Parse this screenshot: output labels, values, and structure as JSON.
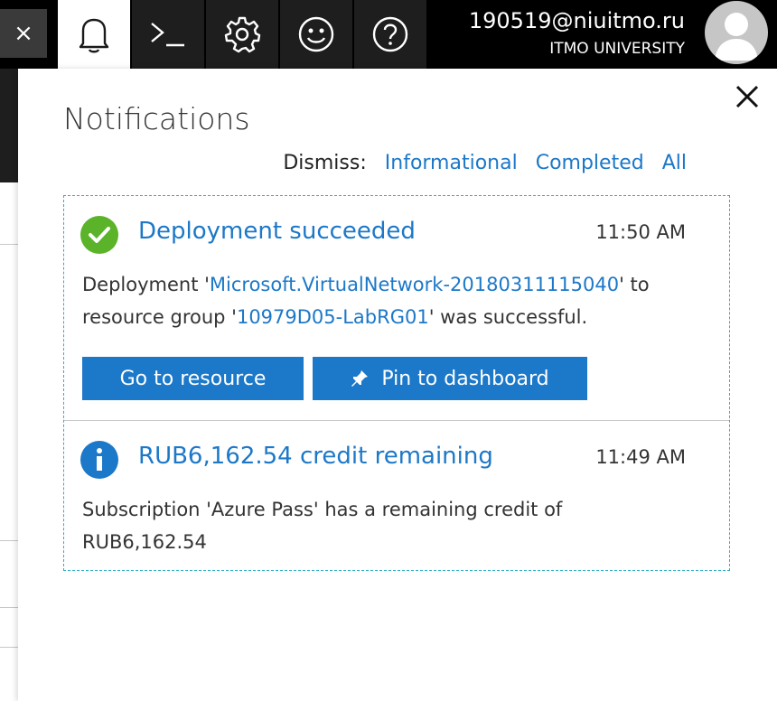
{
  "topbar": {
    "close_label": "×",
    "user_email": "190519@niuitmo.ru",
    "user_org": "ITMO UNIVERSITY",
    "icons": [
      "close-icon",
      "bell-icon",
      "cloud-shell-icon",
      "gear-icon",
      "smiley-icon",
      "help-icon",
      "avatar-icon"
    ]
  },
  "panel": {
    "title": "Notifications",
    "dismiss": {
      "label": "Dismiss:",
      "options": [
        "Informational",
        "Completed",
        "All"
      ]
    }
  },
  "notifications": [
    {
      "status": "success",
      "icon": "checkmark-circle-icon",
      "icon_color": "#5bb32a",
      "title": "Deployment succeeded",
      "time": "11:50 AM",
      "body": {
        "prefix": "Deployment '",
        "deployment_link": "Microsoft.VirtualNetwork-20180311115040",
        "middle": "' to resource group '",
        "group_link": "10979D05-LabRG01",
        "suffix": "' was successful."
      },
      "actions": {
        "go_to_resource": "Go to resource",
        "pin_to_dashboard": "Pin to dashboard"
      }
    },
    {
      "status": "info",
      "icon": "info-circle-icon",
      "icon_color": "#1c78c8",
      "title": "RUB6,162.54 credit remaining",
      "time": "11:49 AM",
      "body_text": "Subscription 'Azure Pass' has a remaining credit of RUB6,162.54"
    }
  ],
  "colors": {
    "accent": "#1c78c8",
    "topbar_bg": "#000000",
    "success": "#5bb32a",
    "border_dashed": "#2ab0c5"
  }
}
